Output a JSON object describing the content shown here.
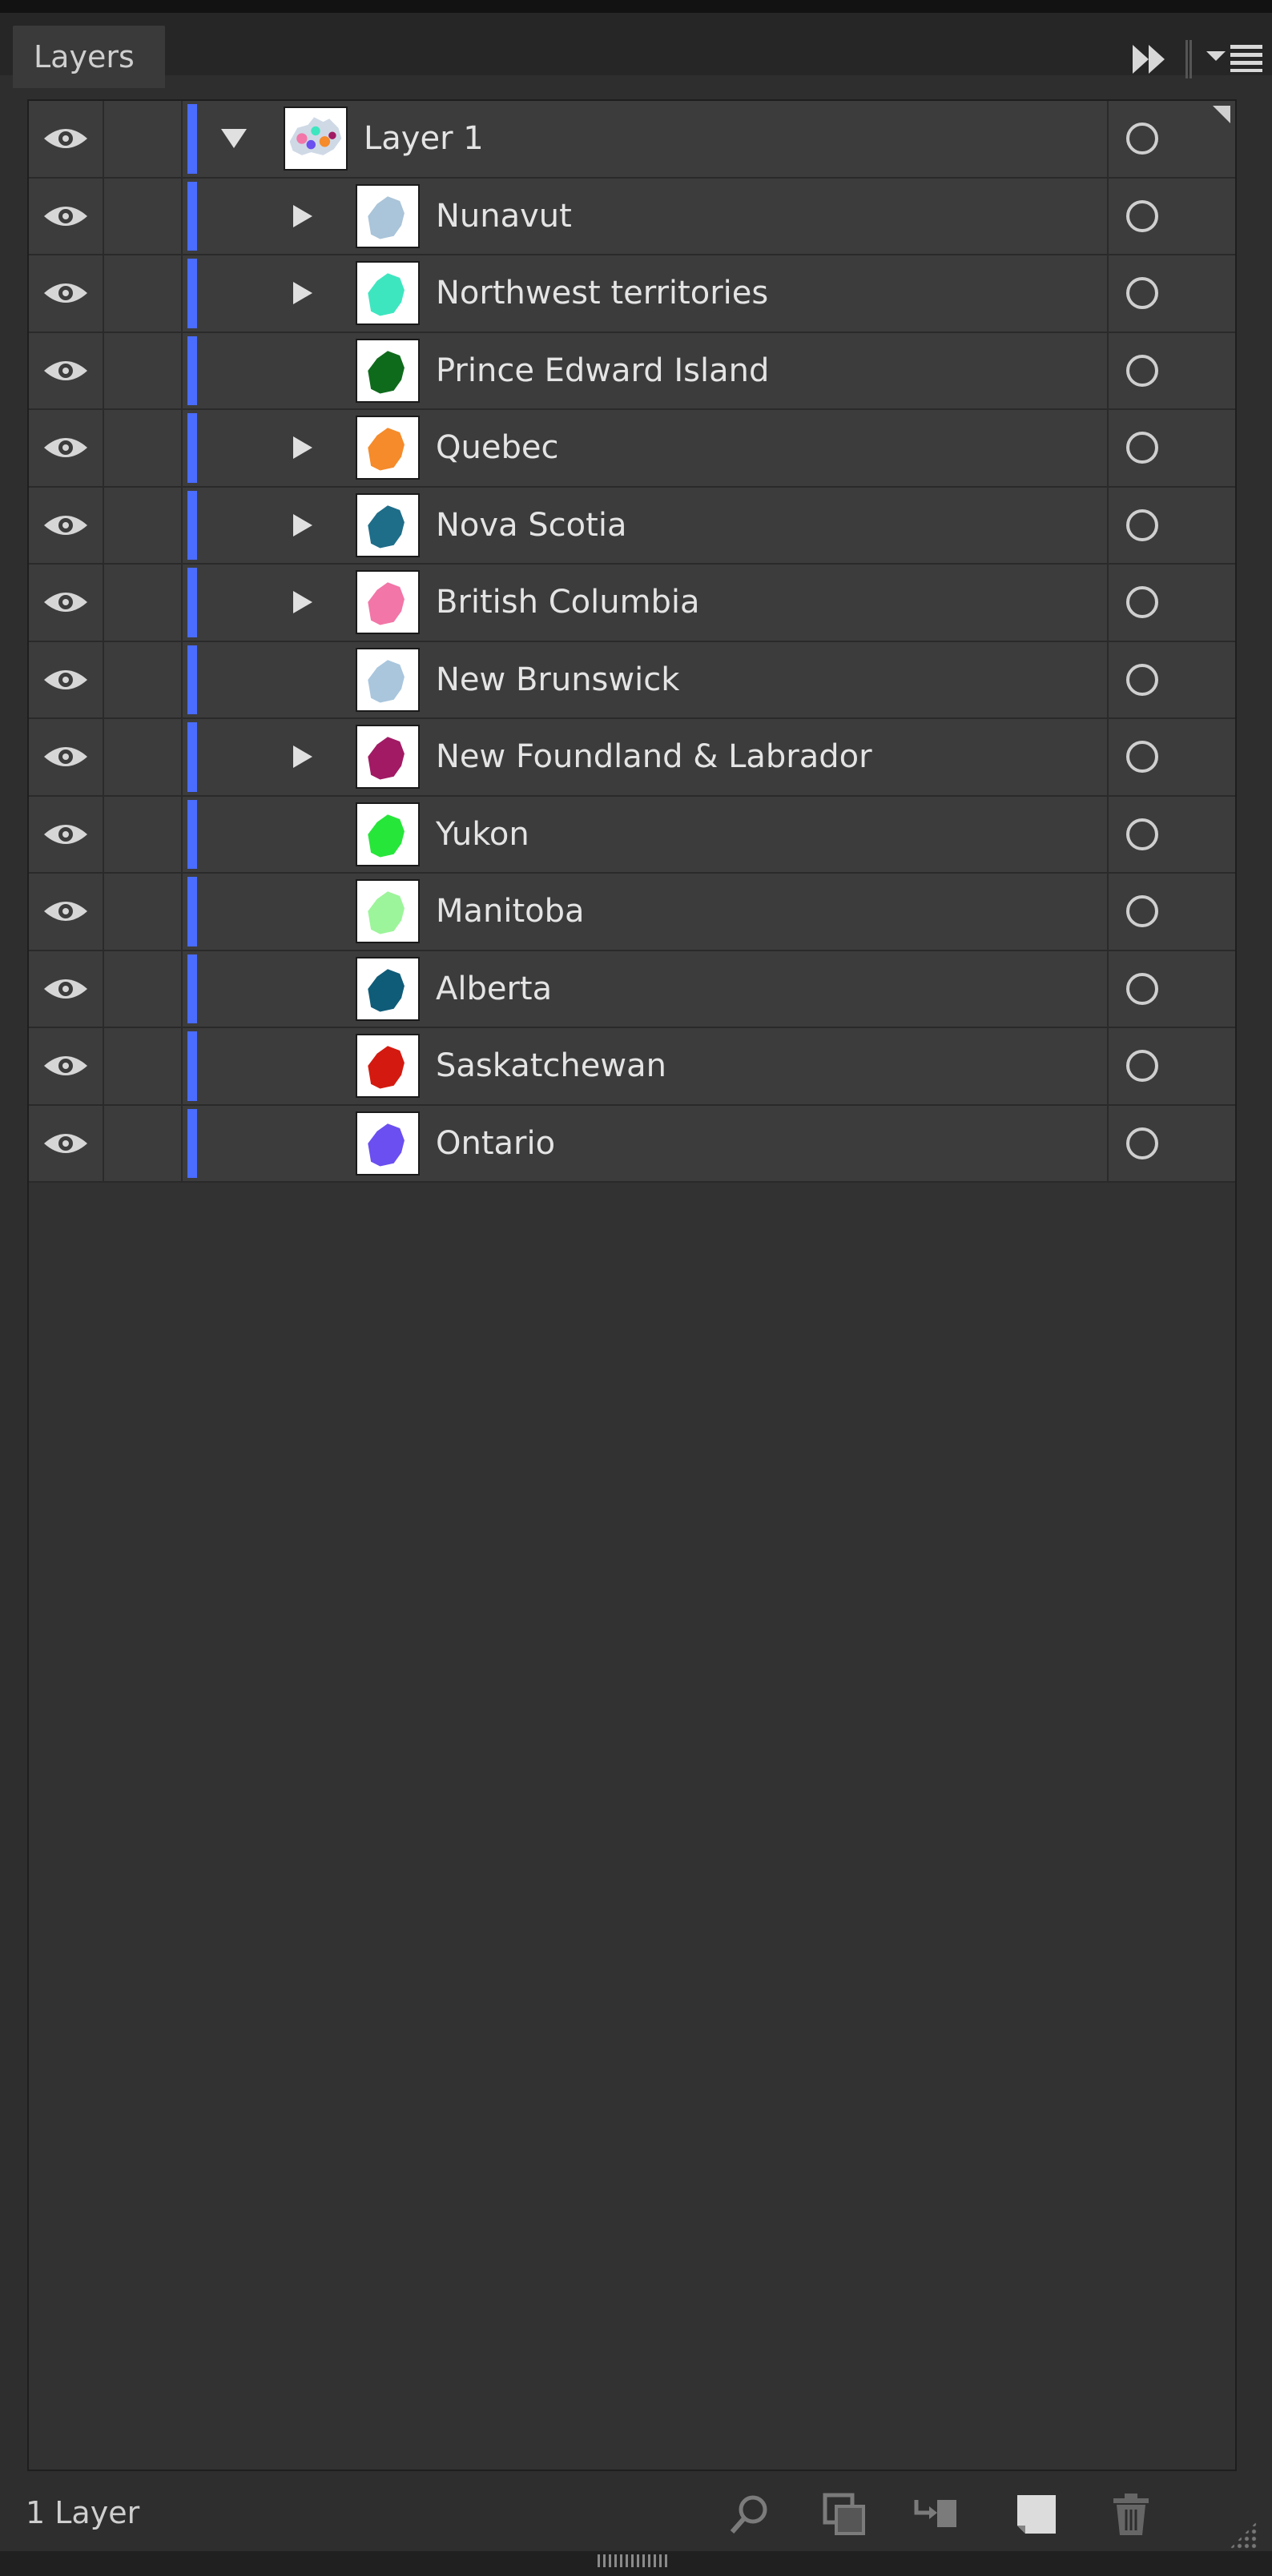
{
  "panel": {
    "tab_title": "Layers",
    "header_icons": [
      "collapse-panels-icon",
      "panel-menu-icon"
    ]
  },
  "layers": {
    "parent": {
      "name": "Layer 1",
      "expanded": true,
      "color": "#4a6cff",
      "thumb_icon": "canada-map-thumbnail"
    },
    "children": [
      {
        "name": "Nunavut",
        "has_children": true,
        "fill": "#aac4d9"
      },
      {
        "name": "Northwest territories",
        "has_children": true,
        "fill": "#3ee6c0"
      },
      {
        "name": "Prince Edward Island",
        "has_children": false,
        "fill": "#0f6b1c"
      },
      {
        "name": "Quebec",
        "has_children": true,
        "fill": "#f58b2a"
      },
      {
        "name": "Nova Scotia",
        "has_children": true,
        "fill": "#1e6e8a"
      },
      {
        "name": "British Columbia",
        "has_children": true,
        "fill": "#f276a8"
      },
      {
        "name": "New Brunswick",
        "has_children": false,
        "fill": "#a9c6dd"
      },
      {
        "name": "New Foundland & Labrador",
        "has_children": true,
        "fill": "#a21a64"
      },
      {
        "name": "Yukon",
        "has_children": false,
        "fill": "#27e63a"
      },
      {
        "name": "Manitoba",
        "has_children": false,
        "fill": "#9cf59a"
      },
      {
        "name": "Alberta",
        "has_children": false,
        "fill": "#0f5c78"
      },
      {
        "name": "Saskatchewan",
        "has_children": false,
        "fill": "#d41a10"
      },
      {
        "name": "Ontario",
        "has_children": false,
        "fill": "#6b4ff0"
      }
    ]
  },
  "footer": {
    "layer_count": "1 Layer",
    "icons": [
      "locate-object-icon",
      "make-clipping-mask-icon",
      "create-sublayer-icon",
      "create-new-layer-icon",
      "delete-layer-icon"
    ]
  }
}
